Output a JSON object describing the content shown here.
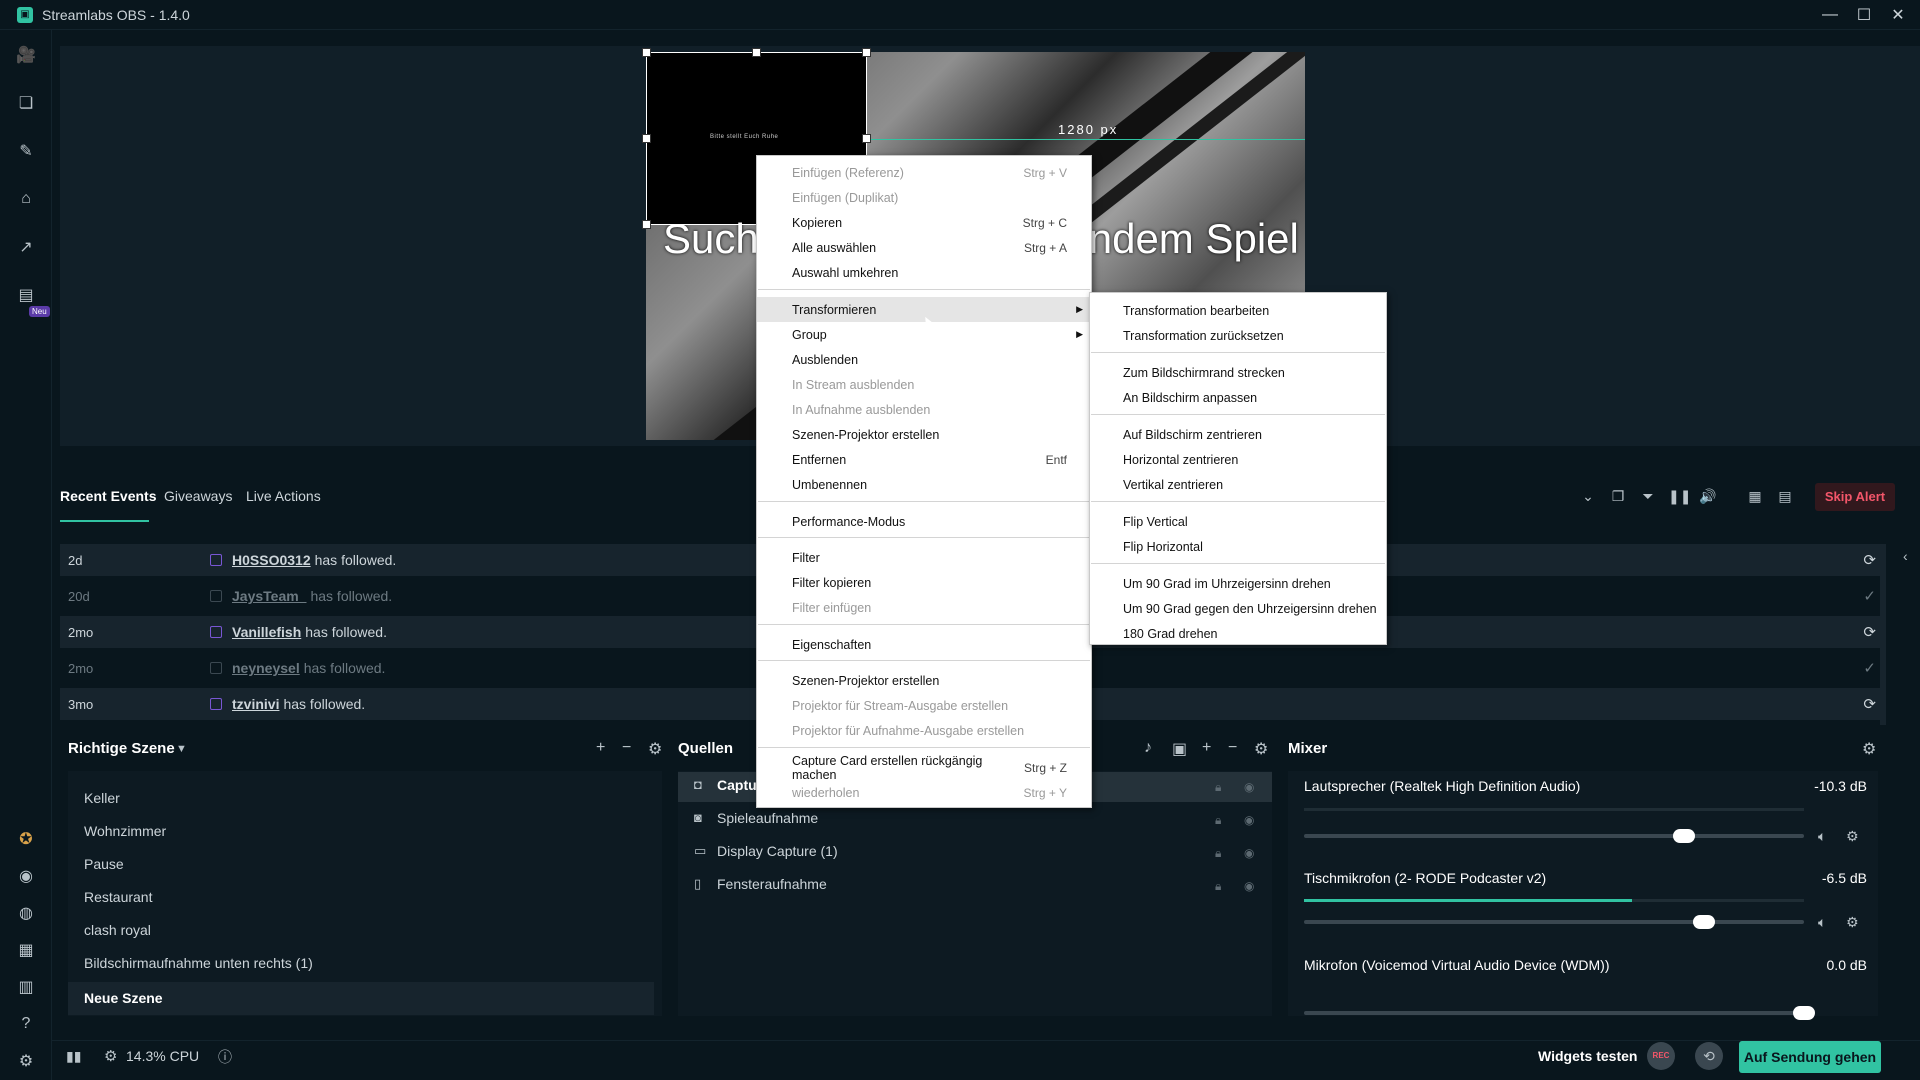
{
  "window": {
    "title": "Streamlabs OBS - 1.4.0",
    "controls": [
      "—",
      "☐",
      "✕"
    ]
  },
  "nav": {
    "new_badge": "Neu"
  },
  "preview": {
    "overlay_text_left": "Such",
    "overlay_text_right": "ndem Spiel",
    "width_label": "1280 px",
    "black_box_text": "Bitte stellt Euch Ruhe"
  },
  "events": {
    "tabs": [
      "Recent Events",
      "Giveaways",
      "Live Actions"
    ],
    "skip_alert": "Skip Alert",
    "rows": [
      {
        "age": "2d",
        "user": "H0SSO0312",
        "text": "has followed.",
        "status": "⟳"
      },
      {
        "age": "20d",
        "user": "JaysTeam_",
        "text": "has followed.",
        "status": "✓"
      },
      {
        "age": "2mo",
        "user": "Vanillefish",
        "text": "has followed.",
        "status": "⟳"
      },
      {
        "age": "2mo",
        "user": "neyneysel",
        "text": "has followed.",
        "status": "✓"
      },
      {
        "age": "3mo",
        "user": "tzvinivi",
        "text": "has followed.",
        "status": "⟳"
      }
    ]
  },
  "scenes": {
    "title": "Richtige Szene",
    "items": [
      "Keller",
      "Wohnzimmer",
      "Pause",
      "Restaurant",
      "clash royal",
      "Bildschirmaufnahme unten rechts (1)",
      "Neue Szene"
    ]
  },
  "sources": {
    "title": "Quellen",
    "items": [
      "Captu",
      "Spieleaufnahme",
      "Display Capture (1)",
      "Fensteraufnahme"
    ]
  },
  "mixer": {
    "title": "Mixer",
    "channels": [
      {
        "name": "Lautsprecher (Realtek High Definition Audio)",
        "db": "-10.3 dB",
        "level": 0.76
      },
      {
        "name": "Tischmikrofon (2- RODE Podcaster v2)",
        "db": "-6.5 dB",
        "level": 0.8
      },
      {
        "name": "Mikrofon (Voicemod Virtual Audio Device (WDM))",
        "db": "0.0 dB",
        "level": 1.0
      }
    ]
  },
  "footer": {
    "cpu": "14.3% CPU",
    "widgets_test": "Widgets testen",
    "rec": "REC",
    "go_live": "Auf Sendung gehen"
  },
  "context_menu": {
    "items": [
      {
        "label": "Einfügen (Referenz)",
        "shortcut": "Strg + V",
        "disabled": true
      },
      {
        "label": "Einfügen (Duplikat)",
        "shortcut": "",
        "disabled": true
      },
      {
        "label": "Kopieren",
        "shortcut": "Strg + C",
        "disabled": false
      },
      {
        "label": "Alle auswählen",
        "shortcut": "Strg + A",
        "disabled": false
      },
      {
        "label": "Auswahl umkehren",
        "shortcut": "",
        "disabled": false
      },
      {
        "label": "Transformieren",
        "shortcut": "",
        "disabled": false,
        "submenu": true
      },
      {
        "label": "Group",
        "shortcut": "",
        "disabled": false,
        "submenu": true
      },
      {
        "label": "Ausblenden",
        "shortcut": "",
        "disabled": false
      },
      {
        "label": "In Stream ausblenden",
        "shortcut": "",
        "disabled": true
      },
      {
        "label": "In Aufnahme ausblenden",
        "shortcut": "",
        "disabled": true
      },
      {
        "label": "Szenen-Projektor erstellen",
        "shortcut": "",
        "disabled": false
      },
      {
        "label": "Entfernen",
        "shortcut": "Entf",
        "disabled": false
      },
      {
        "label": "Umbenennen",
        "shortcut": "",
        "disabled": false
      },
      {
        "label": "Performance-Modus",
        "shortcut": "",
        "disabled": false
      },
      {
        "label": "Filter",
        "shortcut": "",
        "disabled": false
      },
      {
        "label": "Filter kopieren",
        "shortcut": "",
        "disabled": false
      },
      {
        "label": "Filter einfügen",
        "shortcut": "",
        "disabled": true
      },
      {
        "label": "Eigenschaften",
        "shortcut": "",
        "disabled": false
      },
      {
        "label": "Szenen-Projektor erstellen",
        "shortcut": "",
        "disabled": false
      },
      {
        "label": "Projektor für Stream-Ausgabe erstellen",
        "shortcut": "",
        "disabled": true
      },
      {
        "label": "Projektor für Aufnahme-Ausgabe erstellen",
        "shortcut": "",
        "disabled": true
      },
      {
        "label": "Capture Card erstellen rückgängig machen",
        "shortcut": "Strg + Z",
        "disabled": false
      },
      {
        "label": "wiederholen",
        "shortcut": "Strg + Y",
        "disabled": true
      }
    ]
  },
  "transform_submenu": {
    "items": [
      "Transformation bearbeiten",
      "Transformation zurücksetzen",
      "Zum Bildschirmrand strecken",
      "An Bildschirm anpassen",
      "Auf Bildschirm zentrieren",
      "Horizontal zentrieren",
      "Vertikal zentrieren",
      "Flip Vertical",
      "Flip Horizontal",
      "Um 90 Grad im Uhrzeigersinn drehen",
      "Um 90 Grad gegen den Uhrzeigersinn drehen",
      "180 Grad drehen"
    ]
  }
}
